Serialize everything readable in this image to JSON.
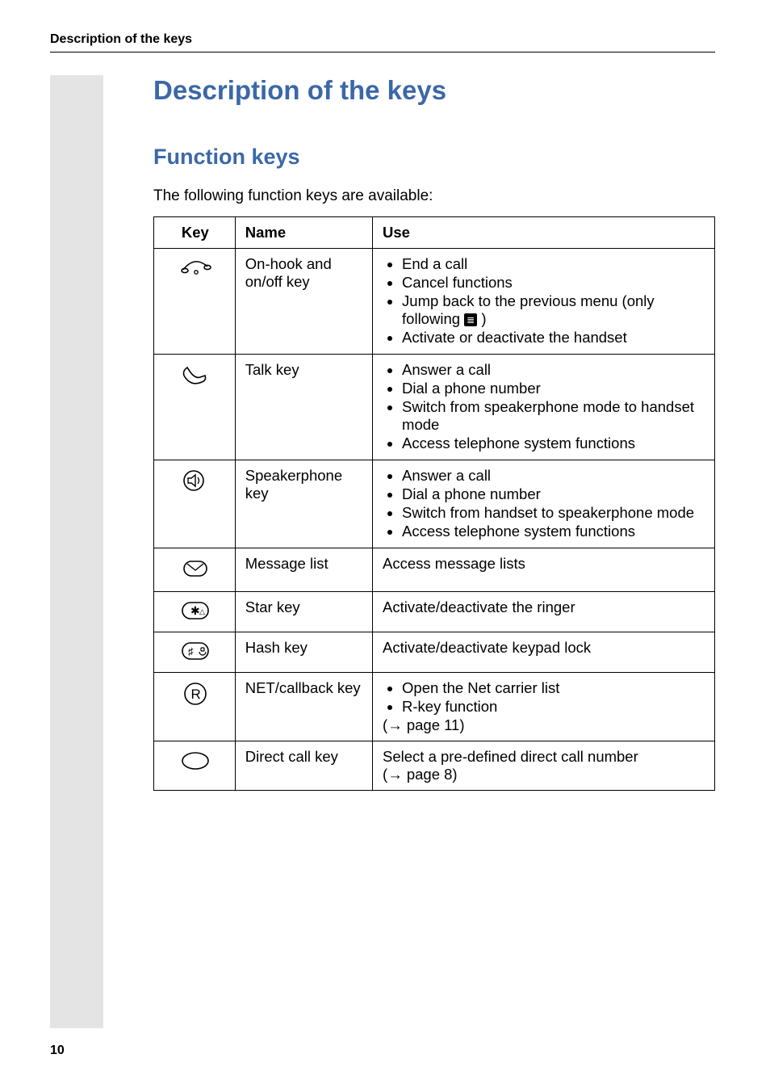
{
  "running_header": "Description of the keys",
  "h1": "Description of the keys",
  "h2": "Function keys",
  "intro": "The following function keys are available:",
  "page_number": "10",
  "columns": {
    "key": "Key",
    "name": "Name",
    "use": "Use"
  },
  "rows": [
    {
      "icon": "on-hook",
      "name": "On-hook and on/off key",
      "use_type": "list",
      "use": [
        "End a call",
        "Cancel functions",
        "Jump back to the previous menu (only following __ICON__ )",
        "Activate or deactivate the handset"
      ]
    },
    {
      "icon": "talk",
      "name": "Talk key",
      "use_type": "list",
      "use": [
        "Answer a call",
        "Dial a phone number",
        "Switch from speakerphone mode to handset mode",
        "Access telephone system functions"
      ]
    },
    {
      "icon": "speaker",
      "name": "Speakerphone key",
      "use_type": "list",
      "use": [
        "Answer a call",
        "Dial a phone number",
        "Switch from handset to speakerphone mode",
        "Access telephone system functions"
      ]
    },
    {
      "icon": "message",
      "name": "Message list",
      "use_type": "text",
      "use_text": "Access message lists"
    },
    {
      "icon": "star",
      "name": "Star key",
      "use_type": "text",
      "use_text": "Activate/deactivate the ringer"
    },
    {
      "icon": "hash",
      "name": "Hash key",
      "use_type": "text",
      "use_text": "Activate/deactivate keypad lock"
    },
    {
      "icon": "r",
      "name": "NET/callback key",
      "use_type": "list_trail",
      "use": [
        "Open the Net carrier list",
        "R-key function"
      ],
      "trail": "(→ page  11)"
    },
    {
      "icon": "direct",
      "name": "Direct call key",
      "use_type": "text_trail",
      "use_text": "Select a pre-defined direct call number",
      "trail": "(→ page  8)"
    }
  ]
}
